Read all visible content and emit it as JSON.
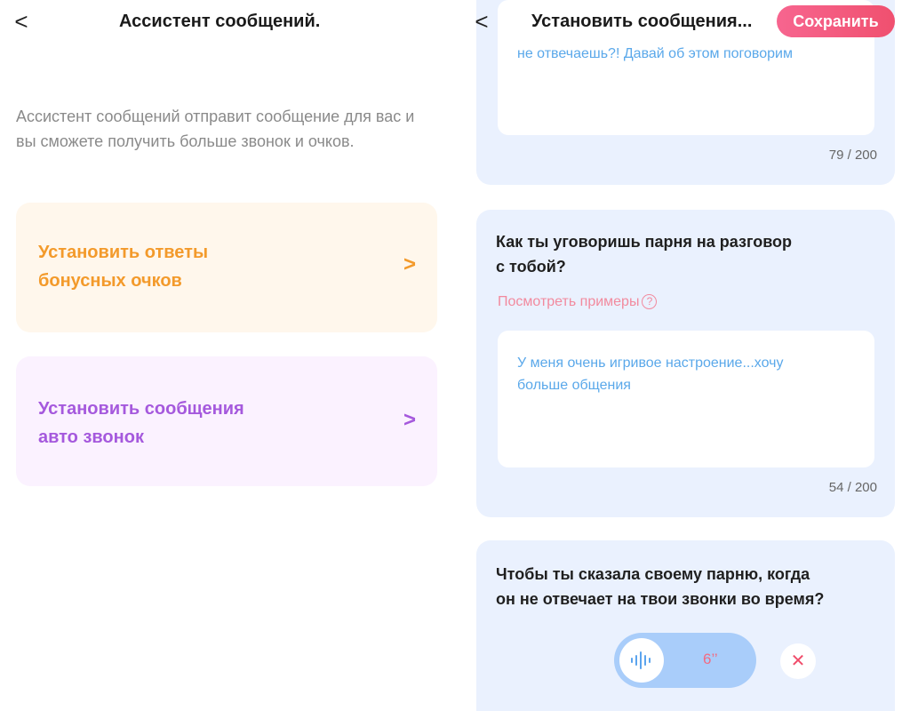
{
  "left": {
    "header": {
      "back": "<",
      "title": "Ассистент сообщений."
    },
    "description": "Ассистент сообщений отправит сообщение для вас и вы сможете получить больше звонок и очков.",
    "options": [
      {
        "line1": "Установить ответы",
        "line2": "бонусных очков",
        "chevron": ">",
        "color": "#f39a2b"
      },
      {
        "line1": "Установить сообщения",
        "line2": "авто звонок",
        "chevron": ">",
        "color": "#a559dd"
      }
    ]
  },
  "right": {
    "header": {
      "back": "<",
      "title": "Установить сообщения...",
      "save_label": "Сохранить"
    },
    "cards": [
      {
        "answer": "не отвечаешь?! Давай об этом поговорим",
        "counter": "79 / 200"
      },
      {
        "question_line1": "Как ты уговоришь парня на разговор",
        "question_line2": "с тобой?",
        "examples_label": "Посмотреть примеры",
        "examples_icon": "?",
        "answer_line1": "У меня очень игривое настроение...хочу",
        "answer_line2": "больше общения",
        "counter": "54 / 200"
      },
      {
        "question_line1": "Чтобы ты сказала своему парню, когда",
        "question_line2": "он не отвечает на твои звонки во время?",
        "voice_duration": "6’’",
        "delete_icon": "✕"
      }
    ]
  },
  "colors": {
    "accent_pink": "#f0506f",
    "card_bg": "#eaf1fe",
    "answer_blue": "#5aa8ea"
  }
}
